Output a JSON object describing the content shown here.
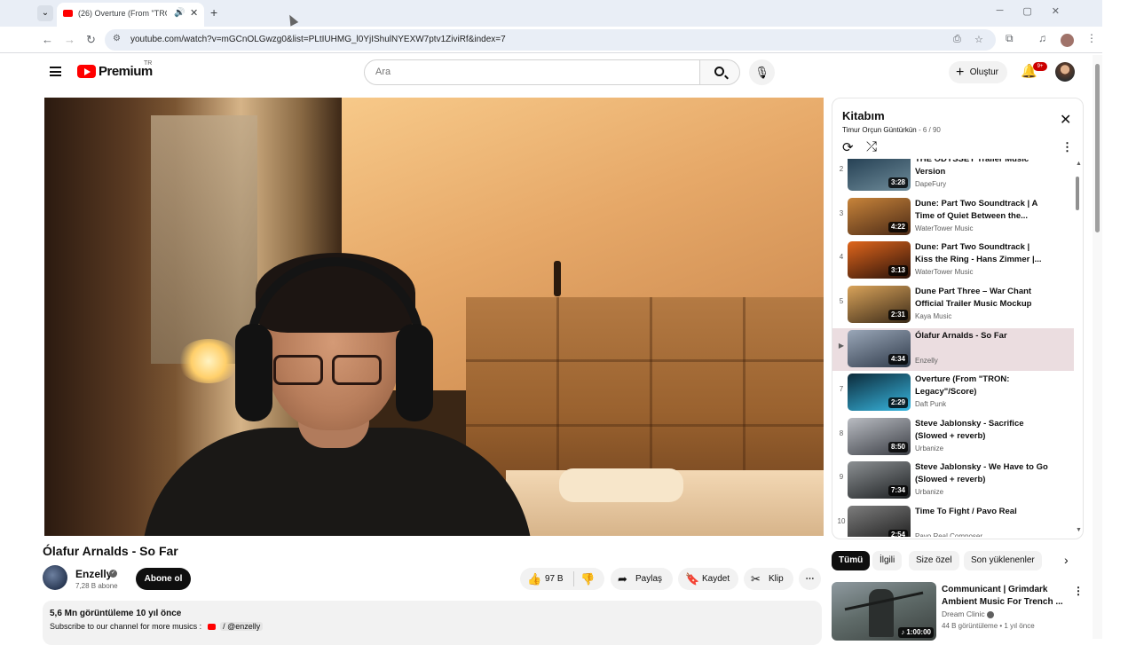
{
  "browser": {
    "tab_title": "(26) Overture (From \"TRON",
    "url": "youtube.com/watch?v=mGCnOLGwzg0&list=PLtIUHMG_l0YjIShulNYEXW7ptv1ZiviRf&index=7",
    "icons": [
      "tab-menu-icon",
      "youtube-favicon",
      "audio-icon",
      "close-icon",
      "plus-icon",
      "minimize-icon",
      "maximize-icon",
      "close-window-icon",
      "back-icon",
      "forward-icon",
      "reload-icon",
      "site-info-icon",
      "install-icon",
      "star-icon",
      "extensions-icon",
      "media-icon",
      "profile-icon",
      "kebab-icon"
    ]
  },
  "header": {
    "brand": "Premium",
    "country": "TR",
    "search_placeholder": "Ara",
    "create_label": "Oluştur",
    "notifications_badge": "9+"
  },
  "video": {
    "title": "Ólafur Arnalds - So Far",
    "channel": "Enzelly",
    "subscribers": "7,28 B abone",
    "subscribe_label": "Abone ol",
    "likes": "97 B",
    "share_label": "Paylaş",
    "save_label": "Kaydet",
    "clip_label": "Klip",
    "description_meta": "5,6 Mn görüntüleme  10 yıl önce",
    "description_text": "Subscribe to our channel for more musics :",
    "description_handle": "/ @enzelly"
  },
  "playlist": {
    "title": "Kitabım",
    "owner": "Timur Orçun Güntürkün",
    "position": "- 6 / 90",
    "items": [
      {
        "index": "2",
        "title": "THE ODYSSEY Trailer Music Version",
        "channel": "DapeFury",
        "duration": "3:28",
        "colors": [
          "#1f3a4e",
          "#6f8c9a"
        ]
      },
      {
        "index": "3",
        "title": "Dune: Part Two Soundtrack | A Time of Quiet Between the...",
        "channel": "WaterTower Music",
        "duration": "4:22",
        "colors": [
          "#c8843a",
          "#4b2a16"
        ]
      },
      {
        "index": "4",
        "title": "Dune: Part Two Soundtrack | Kiss the Ring - Hans Zimmer |...",
        "channel": "WaterTower Music",
        "duration": "3:13",
        "colors": [
          "#e0661c",
          "#2a120a"
        ]
      },
      {
        "index": "5",
        "title": "Dune Part Three – War Chant Official Trailer Music Mockup",
        "channel": "Kaya Music",
        "duration": "2:31",
        "colors": [
          "#d9a35a",
          "#3b2a18"
        ]
      },
      {
        "index": "▶",
        "title": "Ólafur Arnalds - So Far",
        "channel": "Enzelly",
        "duration": "4:34",
        "colors": [
          "#9aa7b8",
          "#2f3a4a"
        ],
        "active": true
      },
      {
        "index": "7",
        "title": "Overture (From \"TRON: Legacy\"/Score)",
        "channel": "Daft Punk",
        "duration": "2:29",
        "colors": [
          "#0c2a3a",
          "#38b7e0"
        ]
      },
      {
        "index": "8",
        "title": "Steve Jablonsky - Sacrifice (Slowed + reverb)",
        "channel": "Urbanize",
        "duration": "8:50",
        "colors": [
          "#b9bcc2",
          "#3b3e45"
        ]
      },
      {
        "index": "9",
        "title": "Steve Jablonsky - We Have to Go (Slowed + reverb)",
        "channel": "Urbanize",
        "duration": "7:34",
        "colors": [
          "#8c9093",
          "#1d2022"
        ]
      },
      {
        "index": "10",
        "title": "Time To Fight / Pavo Real",
        "channel": "Pavo Real Composer",
        "duration": "2:54",
        "colors": [
          "#7d7d7d",
          "#1a1a1a"
        ]
      }
    ]
  },
  "chips": {
    "items": [
      "Tümü",
      "İlgili",
      "Size özel",
      "Son yüklenenler"
    ],
    "selected": "Tümü"
  },
  "recommendation": {
    "title": "Communicant | Grimdark Ambient Music For Trench ...",
    "channel": "Dream Clinic",
    "meta": "44 B görüntüleme • 1 yıl önce",
    "duration": "1:00:00"
  }
}
